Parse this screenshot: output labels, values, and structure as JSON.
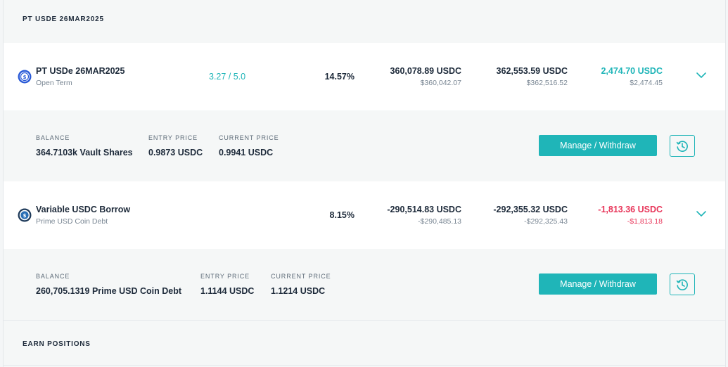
{
  "section_top": {
    "title": "PT USDE 26MAR2025"
  },
  "section_bottom": {
    "title": "EARN POSITIONS"
  },
  "positions": [
    {
      "name": "PT USDe 26MAR2025",
      "subtitle": "Open Term",
      "rating": "3.27 / 5.0",
      "apy": "14.57%",
      "entry_value": "360,078.89 USDC",
      "entry_value_usd": "$360,042.07",
      "current_value": "362,553.59 USDC",
      "current_value_usd": "$362,516.52",
      "pnl": "2,474.70 USDC",
      "pnl_usd": "$2,474.45",
      "pnl_sign": "positive",
      "details": {
        "balance_label": "BALANCE",
        "balance": "364.7103k Vault Shares",
        "entry_price_label": "ENTRY PRICE",
        "entry_price": "0.9873 USDC",
        "current_price_label": "CURRENT PRICE",
        "current_price": "0.9941 USDC",
        "manage_label": "Manage / Withdraw"
      }
    },
    {
      "name": "Variable USDC Borrow",
      "subtitle": "Prime USD Coin Debt",
      "apy": "8.15%",
      "entry_value": "-290,514.83 USDC",
      "entry_value_usd": "-$290,485.13",
      "current_value": "-292,355.32 USDC",
      "current_value_usd": "-$292,325.43",
      "pnl": "-1,813.36 USDC",
      "pnl_usd": "-$1,813.18",
      "pnl_sign": "negative",
      "details": {
        "balance_label": "BALANCE",
        "balance": "260,705.1319 Prime USD Coin Debt",
        "entry_price_label": "ENTRY PRICE",
        "entry_price": "1.1144 USDC",
        "current_price_label": "CURRENT PRICE",
        "current_price": "1.1214 USDC",
        "manage_label": "Manage / Withdraw"
      }
    }
  ],
  "colors": {
    "accent": "#1fb5b8",
    "negative": "#e8365a",
    "text": "#1d2a3a",
    "muted": "#7a8794"
  },
  "icons": {
    "position_1": "usde-token-icon",
    "position_2": "usdc-token-icon",
    "expand": "chevron-down-icon",
    "history": "history-clock-icon"
  }
}
